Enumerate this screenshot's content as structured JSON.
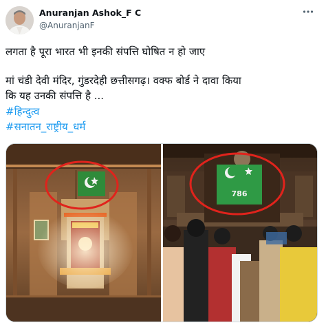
{
  "author": {
    "name": "Anuranjan Ashok_F C",
    "handle": "@AnuranjanF"
  },
  "tweet": {
    "line1": "लगता है पूरा  भारत भी इनकी संपत्ति घोषित न हो जाए",
    "line2": "मां चंडी देवी मंदिर, गुंडरदेही छत्तीसगढ़। वक्फ बोर्ड ने दावा किया",
    "line3": "कि यह उनकी संपत्ति है ...",
    "hashtags": [
      "#हिन्दुत्व",
      "#सनातन_राष्ट्रीय_धर्म"
    ]
  },
  "media": {
    "left_photo": "temple-interior-with-green-flag",
    "right_photo": "temple-crowd-with-green-786-flag",
    "flag_text": "786",
    "highlight_color": "#e0231c"
  },
  "colors": {
    "hashtag": "#1d9bf0",
    "secondary": "#536471"
  }
}
